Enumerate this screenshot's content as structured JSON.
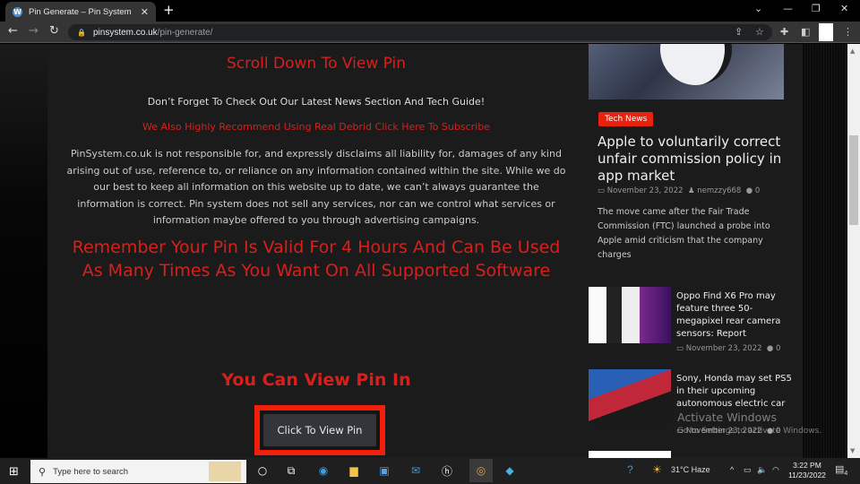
{
  "browser": {
    "tab_title": "Pin Generate – Pin System",
    "tab_favicon": "wordpress-icon",
    "url_host": "pinsystem.co.uk",
    "url_path": "/pin-generate/",
    "icons": [
      "back-icon",
      "forward-icon",
      "reload-icon",
      "lock-icon",
      "share-icon",
      "star-icon",
      "extensions-icon",
      "sidepanel-icon",
      "menu-icon"
    ]
  },
  "main": {
    "scroll_title": "Scroll Down To View Pin",
    "tip": "Don’t Forget To Check Out Our Latest News Section And Tech Guide!",
    "recommend_link": "We Also Highly Recommend Using Real Debrid Click Here To Subscribe",
    "disclaimer": "PinSystem.co.uk is not responsible for, and expressly disclaims all liability for, damages of any kind arising out of use, reference to, or reliance on any information contained within the site. While we do our best to keep all information on this website up to date, we can’t always guarantee the information is correct. Pin system does not sell any services, nor can we control what services or information maybe offered to you through advertising campaigns.",
    "remember": "Remember Your Pin Is Valid For 4 Hours And Can Be Used As Many Times As You Want On All Supported Software",
    "view_in": "You Can View Pin In",
    "view_button": "Click To View Pin"
  },
  "sidebar": {
    "featured": {
      "category": "Tech News",
      "title": "Apple to voluntarily correct unfair commission policy in app market",
      "date": "November 23, 2022",
      "author": "nemzzy668",
      "comments": "0",
      "excerpt": "The move came after the Fair Trade Commission (FTC) launched a probe into Apple amid criticism that the company charges"
    },
    "items": [
      {
        "title": "Oppo Find X6 Pro may feature three 50-megapixel rear camera sensors: Report",
        "date": "November 23, 2022",
        "comments": "0"
      },
      {
        "title": "Sony, Honda may set PS5 in their upcoming autonomous electric car",
        "date": "November 23, 2022",
        "comments": "0"
      }
    ]
  },
  "watermark": {
    "line1": "Activate Windows",
    "line2": "Go to Settings to activate Windows."
  },
  "taskbar": {
    "search_placeholder": "Type here to search",
    "weather": "31°C  Haze",
    "time": "3:22 PM",
    "date": "11/23/2022",
    "notifications": "4"
  },
  "colors": {
    "accent_red": "#d7201c",
    "highlight_border": "#f21f0c",
    "badge_red": "#e8220e"
  }
}
